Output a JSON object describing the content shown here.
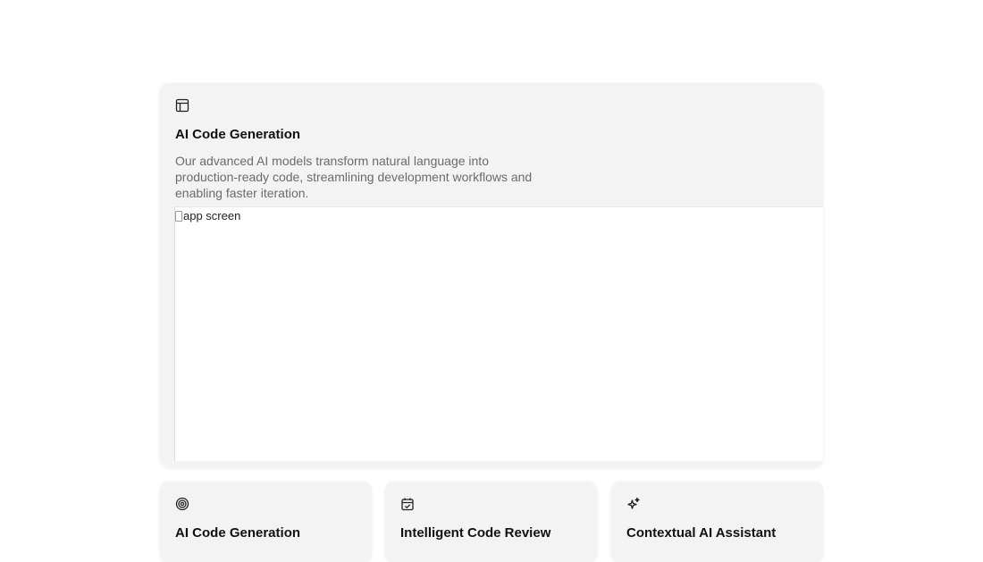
{
  "hero": {
    "icon": "layout-icon",
    "title": "AI Code Generation",
    "description": "Our advanced AI models transform natural language into production-ready code, streamlining development workflows and enabling faster iteration.",
    "image_alt": "app screen"
  },
  "features": [
    {
      "icon": "target-icon",
      "title": "AI Code Generation"
    },
    {
      "icon": "calendar-check-icon",
      "title": "Intelligent Code Review"
    },
    {
      "icon": "sparkles-icon",
      "title": "Contextual AI Assistant"
    }
  ]
}
